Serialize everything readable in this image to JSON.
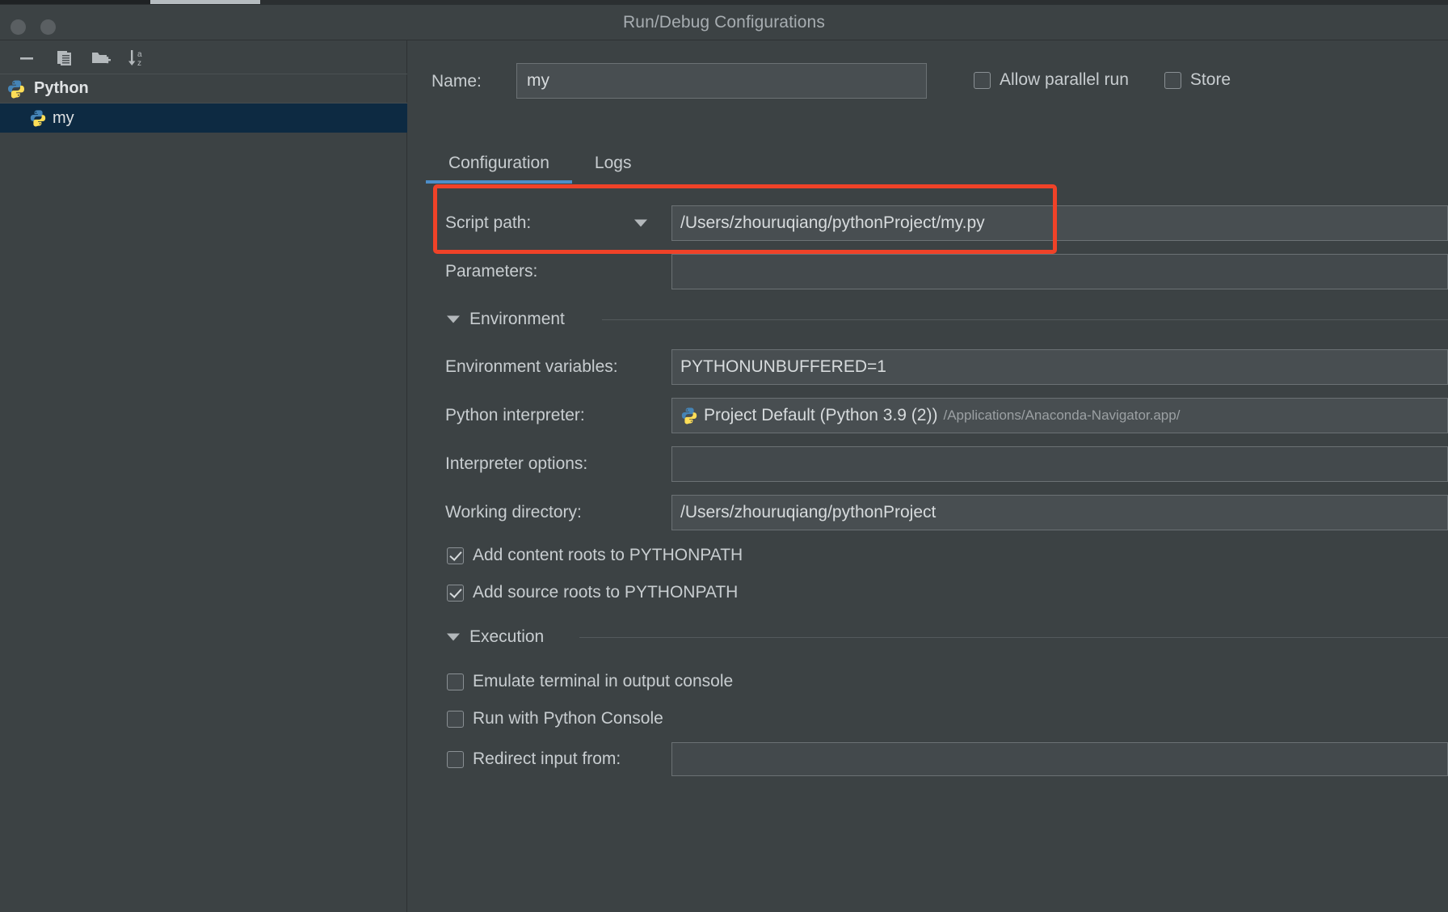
{
  "window": {
    "title": "Run/Debug Configurations",
    "traffic_lights": [
      "close",
      "minimize"
    ]
  },
  "sidebar": {
    "toolbar": [
      {
        "name": "remove-configuration-button",
        "icon": "minus-icon",
        "tooltip": "Remove"
      },
      {
        "name": "copy-configuration-button",
        "icon": "copy-icon",
        "tooltip": "Copy"
      },
      {
        "name": "new-folder-button",
        "icon": "folder-plus-icon",
        "tooltip": "New Folder"
      },
      {
        "name": "sort-configurations-button",
        "icon": "sort-alpha-icon",
        "tooltip": "Sort Configurations"
      }
    ],
    "tree": {
      "group_label": "Python",
      "group_icon": "python-icon",
      "children": [
        {
          "label": "my",
          "icon": "python-icon",
          "selected": true
        }
      ]
    }
  },
  "main": {
    "name_label": "Name:",
    "name_value": "my",
    "name_placeholder": "",
    "top_checkboxes": [
      {
        "label": "Allow parallel run",
        "checked": false
      },
      {
        "label": "Store",
        "checked": false
      }
    ],
    "tabs": [
      {
        "label": "Configuration",
        "active": true
      },
      {
        "label": "Logs",
        "active": false
      }
    ],
    "script_path": {
      "label": "Script path:",
      "value": "/Users/zhouruqiang/pythonProject/my.py",
      "has_dropdown": true,
      "highlighted": true
    },
    "parameters": {
      "label": "Parameters:",
      "value": ""
    },
    "environment_section": {
      "title": "Environment",
      "expanded": true,
      "environment_variables": {
        "label": "Environment variables:",
        "value": "PYTHONUNBUFFERED=1"
      },
      "python_interpreter": {
        "label": "Python interpreter:",
        "value": "Project Default (Python 3.9 (2))",
        "path_hint": "/Applications/Anaconda-Navigator.app/",
        "icon": "python-icon"
      },
      "interpreter_options": {
        "label": "Interpreter options:",
        "value": ""
      },
      "working_directory": {
        "label": "Working directory:",
        "value": "/Users/zhouruqiang/pythonProject"
      },
      "path_checkboxes": [
        {
          "label": "Add content roots to PYTHONPATH",
          "checked": true
        },
        {
          "label": "Add source roots to PYTHONPATH",
          "checked": true
        }
      ]
    },
    "execution_section": {
      "title": "Execution",
      "expanded": true,
      "checkboxes": [
        {
          "label": "Emulate terminal in output console",
          "checked": false
        },
        {
          "label": "Run with Python Console",
          "checked": false
        },
        {
          "label": "Redirect input from:",
          "checked": false,
          "value": ""
        }
      ]
    }
  },
  "annotation": {
    "highlight_color": "#f04228",
    "target": "script-path-row"
  }
}
